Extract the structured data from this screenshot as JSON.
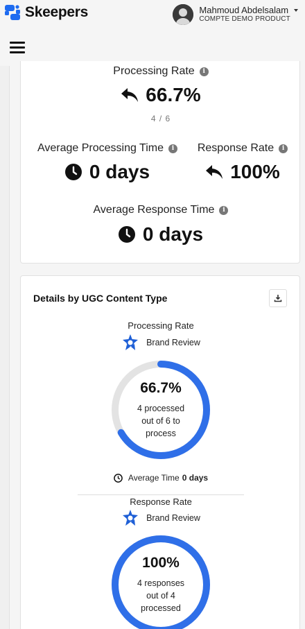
{
  "brand": {
    "name": "Skeepers",
    "accent": "#1e6bf0"
  },
  "user": {
    "name": "Mahmoud Abdelsalam",
    "subtitle": "COMPTE DEMO PRODUCT"
  },
  "summary": {
    "processing_rate": {
      "label": "Processing Rate",
      "value": "66.7%",
      "fraction": "4 / 6",
      "icon": "reply-icon"
    },
    "average_processing_time": {
      "label": "Average Processing Time",
      "value": "0 days",
      "icon": "clock-icon"
    },
    "response_rate": {
      "label": "Response Rate",
      "value": "100%",
      "icon": "reply-icon"
    },
    "average_response_time": {
      "label": "Average Response Time",
      "value": "0 days",
      "icon": "clock-icon"
    }
  },
  "details": {
    "title": "Details by UGC Content Type",
    "processing": {
      "label": "Processing Rate",
      "source": "Brand Review",
      "percent": "66.7%",
      "progress": 0.667,
      "description": "4 processed out of 6 to process",
      "avg_label": "Average Time",
      "avg_value": "0 days"
    },
    "response": {
      "label": "Response Rate",
      "source": "Brand Review",
      "percent": "100%",
      "progress": 1.0,
      "description": "4 responses out of 4 processed"
    }
  }
}
